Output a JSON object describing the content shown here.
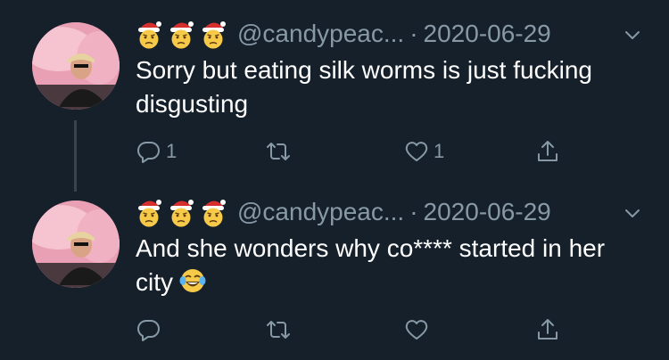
{
  "tweets": [
    {
      "handle": "@candypeac...",
      "separator": "·",
      "date": "2020-06-29",
      "text": "Sorry but eating silk worms is just fucking disgusting",
      "reply_count": "1",
      "retweet_count": "",
      "like_count": "1",
      "name_emojis": [
        "santa-hat-face",
        "santa-hat-face",
        "santa-hat-face"
      ]
    },
    {
      "handle": "@candypeac...",
      "separator": "·",
      "date": "2020-06-29",
      "text": "And she wonders why co**** started in her city",
      "trailing_emoji": "face-with-tears-of-joy",
      "reply_count": "",
      "retweet_count": "",
      "like_count": "",
      "name_emojis": [
        "santa-hat-face",
        "santa-hat-face",
        "santa-hat-face"
      ]
    }
  ],
  "colors": {
    "background": "#15202b",
    "muted": "#8899a6",
    "text": "#ffffff",
    "thread_line": "#38444d"
  },
  "icons": {
    "reply": "reply-icon",
    "retweet": "retweet-icon",
    "like": "heart-icon",
    "share": "share-icon",
    "more": "chevron-down-icon"
  }
}
